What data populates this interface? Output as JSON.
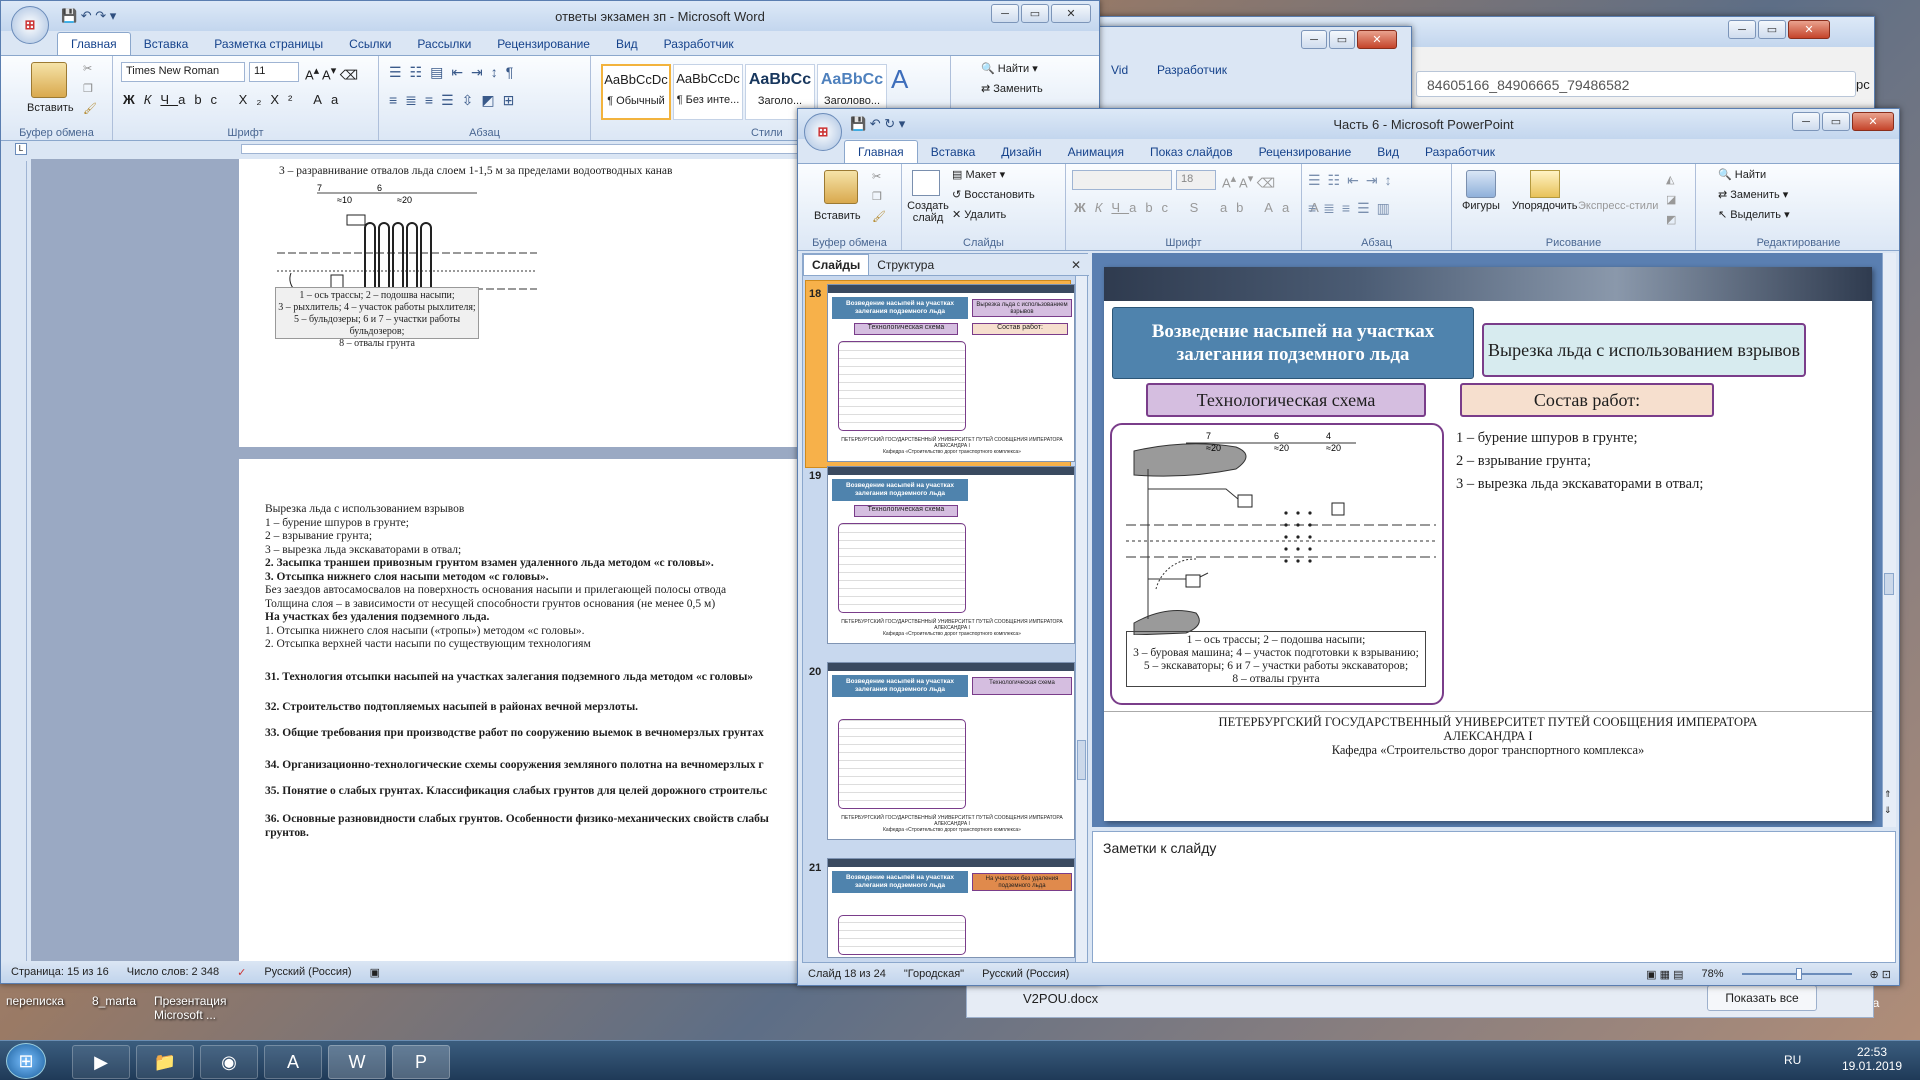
{
  "desktop": {
    "icons": [
      "переписка",
      "8_marta",
      "Презентация Microsoft ..."
    ]
  },
  "taskbar": {
    "lang": "RU",
    "time": "22:53",
    "date": "19.01.2019",
    "show_all": "Показать все",
    "bg_file": "V2POU.docx",
    "side_text": "на"
  },
  "browser": {
    "url": "84605166_84906665_79486582",
    "right_text": "рс",
    "search_text": "Vid",
    "dev_tab": "Разработчик"
  },
  "word": {
    "title": "ответы экзамен зп - Microsoft Word",
    "tabs": [
      "Главная",
      "Вставка",
      "Разметка страницы",
      "Ссылки",
      "Рассылки",
      "Рецензирование",
      "Вид",
      "Разработчик"
    ],
    "groups": {
      "clipboard": "Буфер обмена",
      "font": "Шрифт",
      "paragraph": "Абзац",
      "styles": "Стили"
    },
    "paste": "Вставить",
    "font_name": "Times New Roman",
    "font_size": "11",
    "styles": [
      {
        "sample": "AaBbCcDc",
        "name": "¶ Обычный"
      },
      {
        "sample": "AaBbCcDc",
        "name": "¶ Без инте..."
      },
      {
        "sample": "AaBbCc",
        "name": "Заголо..."
      },
      {
        "sample": "AaBbCc",
        "name": "Заголово..."
      }
    ],
    "find": "Найти",
    "replace": "Заменить",
    "page1_heading": "3 – разравнивание отвалов льда слоем 1-1,5 м за пределами водоотводных  канав",
    "dims": [
      "7",
      "≈10",
      "6",
      "≈20"
    ],
    "legend": [
      "1 – ось трассы; 2 – подошва насыпи;",
      "3 – рыхлитель; 4 – участок работы рыхлителя;",
      "5 – бульдозеры; 6 и 7 – участки работы бульдозеров;",
      "8 – отвалы грунта"
    ],
    "page2_lines": [
      {
        "t": "Вырезка льда с  использованием взрывов",
        "b": false
      },
      {
        "t": "1 – бурение шпуров в грунте;",
        "b": false
      },
      {
        "t": "2 – взрывание грунта;",
        "b": false
      },
      {
        "t": "3 – вырезка льда экскаваторами в отвал;",
        "b": false
      },
      {
        "t": "2. Засыпка траншеи привозным грунтом взамен удаленного льда методом «с головы».",
        "b": true
      },
      {
        "t": "3. Отсыпка нижнего слоя насыпи методом «с головы».",
        "b": true
      },
      {
        "t": "Без заездов автосамосвалов на поверхность основания насыпи и прилегающей полосы отвода",
        "b": false
      },
      {
        "t": "Толщина слоя – в зависимости от несущей способности грунтов основания (не менее 0,5 м)",
        "b": false
      },
      {
        "t": "На участках без удаления подземного льда.",
        "b": true
      },
      {
        "t": "1. Отсыпка нижнего слоя насыпи («тропы») методом «с головы».",
        "b": false
      },
      {
        "t": "2. Отсыпка верхней части насыпи по существующим технологиям",
        "b": false
      }
    ],
    "questions": [
      "31. Технология отсыпки насыпей на участках залегания подземного льда методом «с головы»",
      "32. Строительство подтопляемых насыпей в районах вечной мерзлоты.",
      "33. Общие требования при производстве работ по сооружению выемок в вечномерзлых грунтах",
      "34. Организационно-технологические схемы сооружения земляного полотна на вечномерзлых г",
      "35. Понятие о слабых грунтах. Классификация слабых грунтов для целей дорожного строительс",
      "36. Основные разновидности слабых грунтов. Особенности физико-механических свойств слабы"
    ],
    "q36_cont": "грунтов.",
    "status": {
      "page": "Страница: 15 из 16",
      "words": "Число слов: 2 348",
      "lang": "Русский (Россия)"
    }
  },
  "ppt": {
    "title": "Часть 6 - Microsoft PowerPoint",
    "tabs": [
      "Главная",
      "Вставка",
      "Дизайн",
      "Анимация",
      "Показ слайдов",
      "Рецензирование",
      "Вид",
      "Разработчик"
    ],
    "groups": {
      "clipboard": "Буфер обмена",
      "slides": "Слайды",
      "font": "Шрифт",
      "paragraph": "Абзац",
      "drawing": "Рисование",
      "editing": "Редактирование"
    },
    "paste": "Вставить",
    "create_slide": "Создать слайд",
    "layout": "Макет",
    "reset": "Восстановить",
    "delete": "Удалить",
    "font_size": "18",
    "shapes": "Фигуры",
    "arrange": "Упорядочить",
    "quick_styles": "Экспресс-стили",
    "find": "Найти",
    "replace": "Заменить",
    "select": "Выделить",
    "pane_tabs": [
      "Слайды",
      "Структура"
    ],
    "thumbs": [
      {
        "num": "18",
        "title": "Возведение насыпей на участках залегания подземного льда",
        "tag": "Вырезка льда с использованием взрывов",
        "sub": "Технологическая схема",
        "sub2": "Состав работ:"
      },
      {
        "num": "19",
        "title": "Возведение насыпей на участках залегания подземного льда",
        "tag": "",
        "sub": "Технологическая схема",
        "sub2": ""
      },
      {
        "num": "20",
        "title": "Возведение насыпей на участках залегания подземного льда",
        "tag": "Технологическая схема",
        "sub": "",
        "sub2": ""
      },
      {
        "num": "21",
        "title": "Возведение насыпей на участках залегания подземного льда",
        "tag": "На участках без удаления подземного льда",
        "sub": "",
        "sub2": ""
      }
    ],
    "thumb_footer": "ПЕТЕРБУРГСКИЙ ГОСУДАРСТВЕННЫЙ УНИВЕРСИТЕТ ПУТЕЙ СООБЩЕНИЯ ИМПЕРАТОРА АЛЕКСАНДРА I",
    "thumb_footer2": "Кафедра «Строительство дорог транспортного комплекса»",
    "slide": {
      "title": "Возведение насыпей на участках залегания подземного льда",
      "tag": "Вырезка льда с использованием взрывов",
      "scheme": "Технологическая схема",
      "works": "Состав работ:",
      "work_items": [
        "1 – бурение шпуров в грунте;",
        "2 – взрывание грунта;",
        "3 – вырезка льда экскаваторами в отвал;"
      ],
      "dims": [
        "7",
        "≈20",
        "6",
        "≈20",
        "4",
        "≈20"
      ],
      "legend": [
        "1 – ось трассы; 2 – подошва насыпи;",
        "3 – буровая машина; 4 – участок подготовки к взрыванию;",
        "5 – экскаваторы; 6 и 7 – участки работы экскаваторов;",
        "8 – отвалы грунта"
      ],
      "footer1": "ПЕТЕРБУРГСКИЙ ГОСУДАРСТВЕННЫЙ УНИВЕРСИТЕТ ПУТЕЙ СООБЩЕНИЯ ИМПЕРАТОРА",
      "footer2": "АЛЕКСАНДРА I",
      "footer3": "Кафедра «Строительство дорог транспортного комплекса»"
    },
    "notes": "Заметки к слайду",
    "status": {
      "slide": "Слайд 18 из 24",
      "theme": "\"Городская\"",
      "lang": "Русский (Россия)",
      "zoom": "78%"
    }
  }
}
